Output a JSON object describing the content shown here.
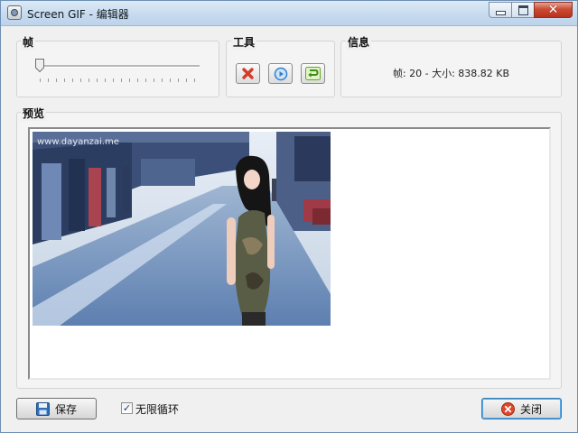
{
  "window": {
    "title": "Screen GIF - 编辑器",
    "buttons": {
      "minimize": "minimize-icon",
      "maximize": "maximize-icon",
      "close": "close-icon"
    }
  },
  "frame_group": {
    "title": "帧"
  },
  "tools_group": {
    "title": "工具",
    "tools": [
      {
        "icon": "delete-icon",
        "color": "#d43b2a"
      },
      {
        "icon": "play-icon",
        "color": "#2f7fd1"
      },
      {
        "icon": "reverse-icon",
        "color": "#4aa51f"
      }
    ]
  },
  "info_group": {
    "title": "信息",
    "text": "帧: 20 - 大小: 838.82 KB"
  },
  "preview_group": {
    "title": "预览",
    "watermark": "www.dayanzai.me"
  },
  "footer": {
    "save_label": "保存",
    "loop_label": "无限循环",
    "loop_checked": true,
    "close_label": "关闭"
  }
}
